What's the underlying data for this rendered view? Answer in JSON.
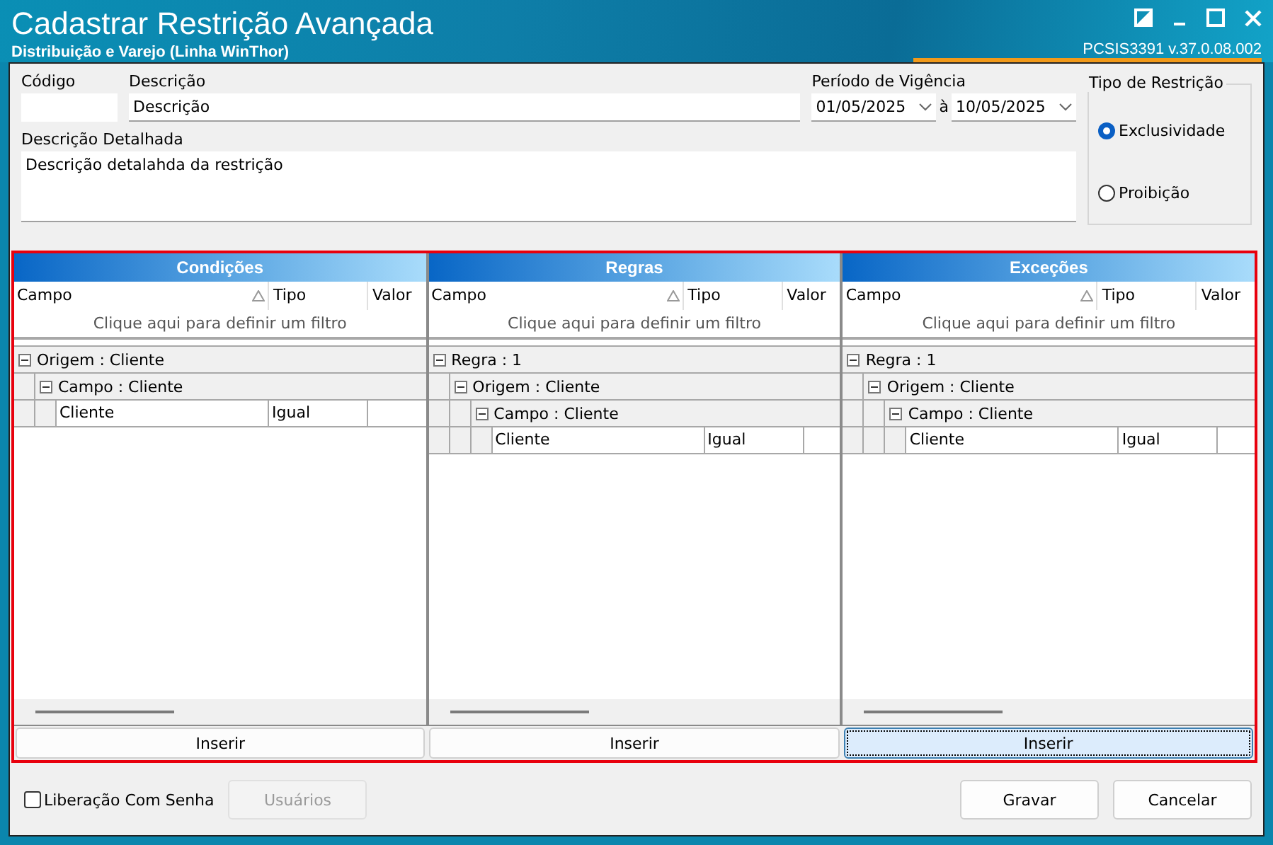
{
  "window": {
    "title": "Cadastrar Restrição Avançada",
    "subtitle": "Distribuição e Varejo (Linha WinThor)",
    "version": "PCSIS3391  v.37.0.08.002"
  },
  "form": {
    "codigo": {
      "label": "Código"
    },
    "descricao": {
      "label": "Descrição",
      "value": "Descrição"
    },
    "periodo": {
      "label": "Período de Vigência",
      "start": "01/05/2025",
      "separator": "à",
      "end": "10/05/2025"
    },
    "descricao_detalhada": {
      "label": "Descrição Detalhada",
      "value": "Descrição detalahda da restrição"
    },
    "tipo_restricao": {
      "label": "Tipo de Restrição",
      "options": [
        {
          "label": "Exclusividade",
          "selected": true
        },
        {
          "label": "Proibição",
          "selected": false
        }
      ]
    }
  },
  "panels": [
    {
      "title": "Condições",
      "columns": [
        "Campo",
        "Tipo",
        "Valor"
      ],
      "filter_hint": "Clique aqui para definir um filtro",
      "button": {
        "label": "Inserir",
        "focused": false
      },
      "tree": [
        {
          "label": "Origem : Cliente",
          "expanded": true,
          "children": [
            {
              "label": "Campo : Cliente",
              "expanded": true,
              "rows": [
                {
                  "campo": "Cliente",
                  "tipo": "Igual"
                }
              ]
            }
          ]
        }
      ]
    },
    {
      "title": "Regras",
      "columns": [
        "Campo",
        "Tipo",
        "Valor"
      ],
      "filter_hint": "Clique aqui para definir um filtro",
      "button": {
        "label": "Inserir",
        "focused": false
      },
      "tree": [
        {
          "label": "Regra : 1",
          "expanded": true,
          "children": [
            {
              "label": "Origem : Cliente",
              "expanded": true,
              "children": [
                {
                  "label": "Campo : Cliente",
                  "expanded": true,
                  "rows": [
                    {
                      "campo": "Cliente",
                      "tipo": "Igual"
                    }
                  ]
                }
              ]
            }
          ]
        }
      ]
    },
    {
      "title": "Exceções",
      "columns": [
        "Campo",
        "Tipo",
        "Valor"
      ],
      "filter_hint": "Clique aqui para definir um filtro",
      "button": {
        "label": "Inserir",
        "focused": true
      },
      "tree": [
        {
          "label": "Regra : 1",
          "expanded": true,
          "children": [
            {
              "label": "Origem : Cliente",
              "expanded": true,
              "children": [
                {
                  "label": "Campo : Cliente",
                  "expanded": true,
                  "rows": [
                    {
                      "campo": "Cliente",
                      "tipo": "Igual"
                    }
                  ]
                }
              ]
            }
          ]
        }
      ]
    }
  ],
  "footer": {
    "liberacao": {
      "label": "Liberação Com Senha",
      "checked": false
    },
    "usuarios": {
      "label": "Usuários",
      "disabled": true
    },
    "buttons": [
      "Gravar",
      "Cancelar"
    ]
  }
}
